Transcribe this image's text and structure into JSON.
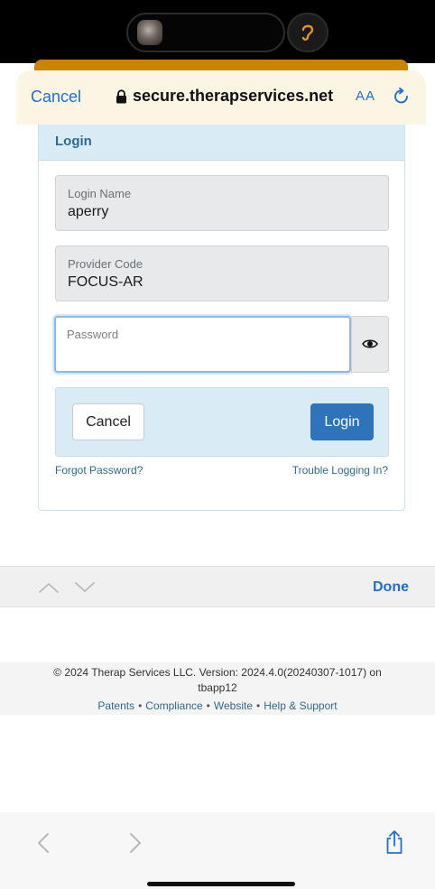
{
  "browser": {
    "cancel_label": "Cancel",
    "url": "secure.therapservices.net",
    "text_size_label": "AA",
    "reload_icon": "reload-icon",
    "lock_icon": "lock-icon"
  },
  "login": {
    "title": "Login",
    "login_name": {
      "label": "Login Name",
      "value": "aperry"
    },
    "provider_code": {
      "label": "Provider Code",
      "value": "FOCUS-AR"
    },
    "password": {
      "placeholder": "Password",
      "value": ""
    },
    "show_password_icon": "eye-icon",
    "cancel_button": "Cancel",
    "login_button": "Login",
    "forgot_password": "Forgot Password?",
    "trouble_logging_in": "Trouble Logging In?"
  },
  "keyboard_accessory": {
    "previous_icon": "chevron-up-icon",
    "next_icon": "chevron-down-icon",
    "done_label": "Done"
  },
  "footer": {
    "copyright_line1": "© 2024 Therap Services LLC. Version: 2024.4.0(20240307-1017) on",
    "copyright_line2": "tbapp12",
    "links": [
      "Patents",
      "Compliance",
      "Website",
      "Help & Support"
    ],
    "separator": "•"
  },
  "toolbar": {
    "back_icon": "chevron-left-icon",
    "forward_icon": "chevron-right-icon",
    "share_icon": "share-icon"
  },
  "colors": {
    "accent_blue": "#1f6fd6",
    "login_button": "#2f73ba",
    "panel_blue": "#d9ebf5",
    "header_bg": "#fbf6e4",
    "orange_tab": "#c98500"
  }
}
